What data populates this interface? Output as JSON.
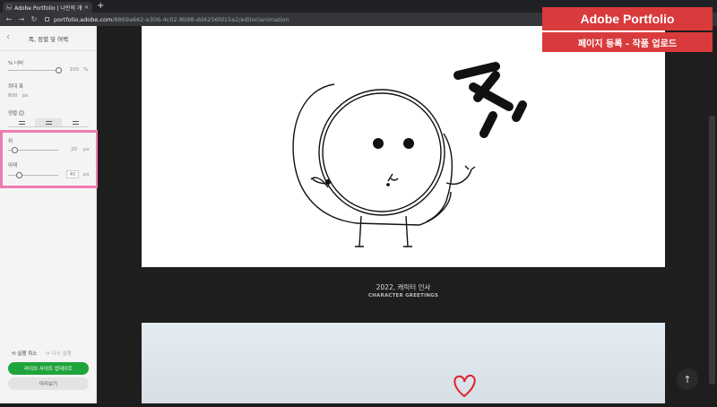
{
  "browser": {
    "tab_title": "Adobe Portfolio | 나만의 개인 포",
    "tab_favicon": "Ae",
    "new_tab": "+",
    "url_domain": "portfolio.adobe.com",
    "url_path": "/8869a662-e306-4c02-8b98-dd4256fd15e2/editor/animation"
  },
  "sidebar": {
    "title": "폭, 정렬 및 여백",
    "width_label": "% 너비",
    "width_value": "100",
    "width_unit": "%",
    "max_width_label": "최대 폭",
    "max_width_value": "800",
    "max_width_unit": "px",
    "align_label": "정렬",
    "top_label": "위",
    "top_value": "20",
    "top_unit": "px",
    "bottom_label": "아래",
    "bottom_value": "40",
    "bottom_unit": "px",
    "undo": "실행 취소",
    "redo": "다시 실행",
    "update_button": "라이브 사이트 업데이트",
    "preview_button": "미리보기"
  },
  "main": {
    "caption_title": "2022, 캐릭터 인사",
    "caption_sub": "CHARACTER GREETINGS",
    "drawing_text": "Hi"
  },
  "overlay": {
    "line1": "Adobe Portfolio",
    "line2": "페이지 등록 - 작품 업로드"
  },
  "colors": {
    "highlight": "#f07bb2",
    "update_green": "#1fa33b",
    "overlay_red": "#d93a3c",
    "heart_red": "#e0242a"
  }
}
